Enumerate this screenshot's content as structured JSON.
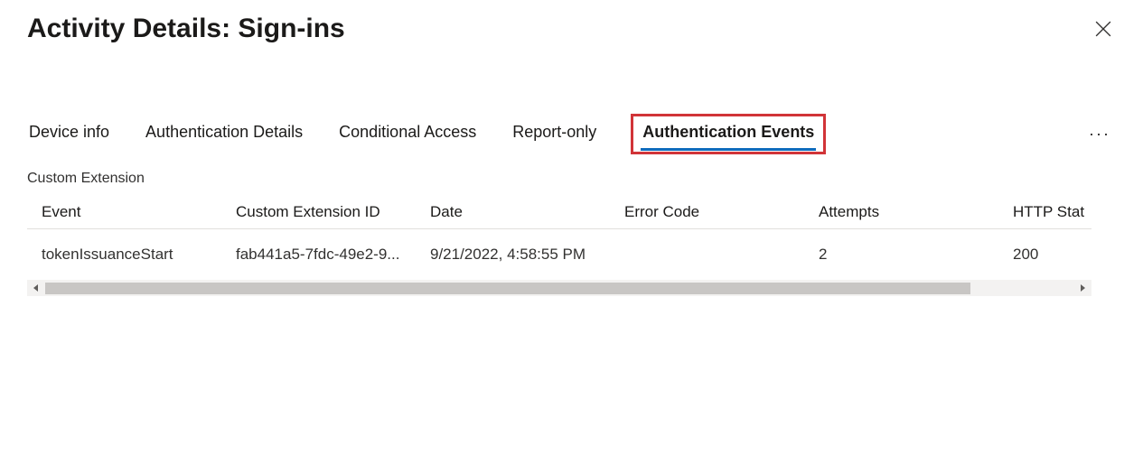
{
  "header": {
    "title": "Activity Details: Sign-ins"
  },
  "tabs": {
    "items": [
      {
        "label": "Device info"
      },
      {
        "label": "Authentication Details"
      },
      {
        "label": "Conditional Access"
      },
      {
        "label": "Report-only"
      },
      {
        "label": "Authentication Events"
      }
    ],
    "active_index": 4
  },
  "section": {
    "title": "Custom Extension"
  },
  "table": {
    "columns": [
      "Event",
      "Custom Extension ID",
      "Date",
      "Error Code",
      "Attempts",
      "HTTP Stat"
    ],
    "rows": [
      {
        "event": "tokenIssuanceStart",
        "custom_extension_id": "fab441a5-7fdc-49e2-9...",
        "date": "9/21/2022, 4:58:55 PM",
        "error_code": "",
        "attempts": "2",
        "http_stat": "200"
      }
    ]
  }
}
